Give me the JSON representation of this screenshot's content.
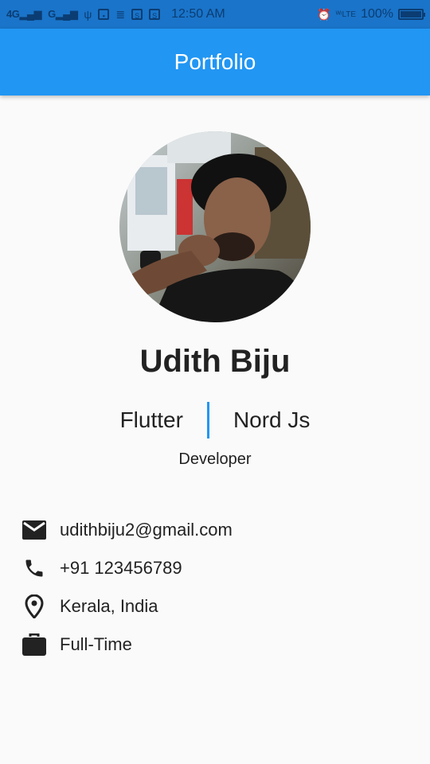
{
  "status_bar": {
    "network1": "4G",
    "network2": "G",
    "time": "12:50 AM",
    "battery": "100%"
  },
  "app_bar": {
    "title": "Portfolio"
  },
  "profile": {
    "name": "Udith Biju",
    "skills": [
      "Flutter",
      "Nord Js"
    ],
    "role": "Developer"
  },
  "contact": {
    "email": "udithbiju2@gmail.com",
    "phone": "+91 123456789",
    "location": "Kerala, India",
    "job_type": "Full-Time"
  },
  "colors": {
    "primary": "#2196f3",
    "status_bar": "#1a74c9",
    "background": "#fafafa",
    "divider": "#2196f3"
  }
}
